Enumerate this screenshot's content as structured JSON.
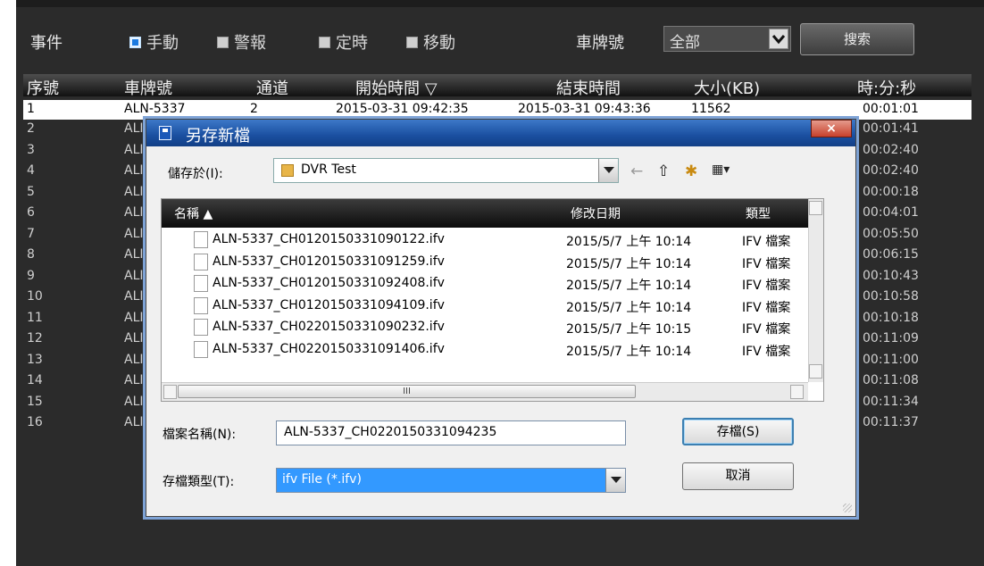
{
  "toolbar": {
    "event_label": "事件",
    "filters": [
      {
        "label": "手動",
        "checked": true
      },
      {
        "label": "警報",
        "checked": false
      },
      {
        "label": "定時",
        "checked": false
      },
      {
        "label": "移動",
        "checked": false
      }
    ],
    "plate_label": "車牌號",
    "plate_value": "全部",
    "search_label": "搜索"
  },
  "table": {
    "headers": [
      "序號",
      "車牌號",
      "通道",
      "開始時間 ▽",
      "結束時間",
      "大小(KB)",
      "時:分:秒"
    ],
    "first_row": {
      "index": "1",
      "plate": "ALN-5337",
      "channel": "2",
      "start": "2015-03-31 09:42:35",
      "end": "2015-03-31 09:43:36",
      "size": "11562",
      "duration": "00:01:01"
    },
    "rows": [
      {
        "index": "2",
        "plate": "ALI",
        "duration": "00:01:41"
      },
      {
        "index": "3",
        "plate": "ALI",
        "duration": "00:02:40"
      },
      {
        "index": "4",
        "plate": "ALI",
        "duration": "00:02:40"
      },
      {
        "index": "5",
        "plate": "ALI",
        "duration": "00:00:18"
      },
      {
        "index": "6",
        "plate": "ALI",
        "duration": "00:04:01"
      },
      {
        "index": "7",
        "plate": "ALI",
        "duration": "00:05:50"
      },
      {
        "index": "8",
        "plate": "ALI",
        "duration": "00:06:15"
      },
      {
        "index": "9",
        "plate": "ALI",
        "duration": "00:10:43"
      },
      {
        "index": "10",
        "plate": "ALI",
        "duration": "00:10:58"
      },
      {
        "index": "11",
        "plate": "ALI",
        "duration": "00:10:18"
      },
      {
        "index": "12",
        "plate": "ALI",
        "duration": "00:11:09"
      },
      {
        "index": "13",
        "plate": "ALI",
        "duration": "00:11:00"
      },
      {
        "index": "14",
        "plate": "ALI",
        "duration": "00:11:08"
      },
      {
        "index": "15",
        "plate": "ALI",
        "duration": "00:11:34"
      },
      {
        "index": "16",
        "plate": "ALI",
        "duration": "00:11:37"
      }
    ]
  },
  "dialog": {
    "title": "另存新檔",
    "close_label": "×",
    "save_in_label": "儲存於(I):",
    "save_in_value": "DVR Test",
    "toolbar_icons": [
      "←",
      "⇧",
      "✱",
      "▦▾"
    ],
    "columns": [
      "名稱 ▲",
      "修改日期",
      "類型"
    ],
    "files": [
      {
        "name": "ALN-5337_CH0120150331090122.ifv",
        "date": "2015/5/7 上午 10:14",
        "type": "IFV 檔案"
      },
      {
        "name": "ALN-5337_CH0120150331091259.ifv",
        "date": "2015/5/7 上午 10:14",
        "type": "IFV 檔案"
      },
      {
        "name": "ALN-5337_CH0120150331092408.ifv",
        "date": "2015/5/7 上午 10:14",
        "type": "IFV 檔案"
      },
      {
        "name": "ALN-5337_CH0120150331094109.ifv",
        "date": "2015/5/7 上午 10:14",
        "type": "IFV 檔案"
      },
      {
        "name": "ALN-5337_CH0220150331090232.ifv",
        "date": "2015/5/7 上午 10:15",
        "type": "IFV 檔案"
      },
      {
        "name": "ALN-5337_CH0220150331091406.ifv",
        "date": "2015/5/7 上午 10:14",
        "type": "IFV 檔案"
      }
    ],
    "hscroll_grip": "III",
    "filename_label": "檔案名稱(N):",
    "filename_value": "ALN-5337_CH0220150331094235",
    "filetype_label": "存檔類型(T):",
    "filetype_value": "ifv File (*.ifv)",
    "save_button": "存檔(S)",
    "cancel_button": "取消"
  },
  "colors": {
    "panel_bg": "#2b2b2b",
    "title_bar": "#1a4fa0",
    "selection": "#3399ff"
  }
}
